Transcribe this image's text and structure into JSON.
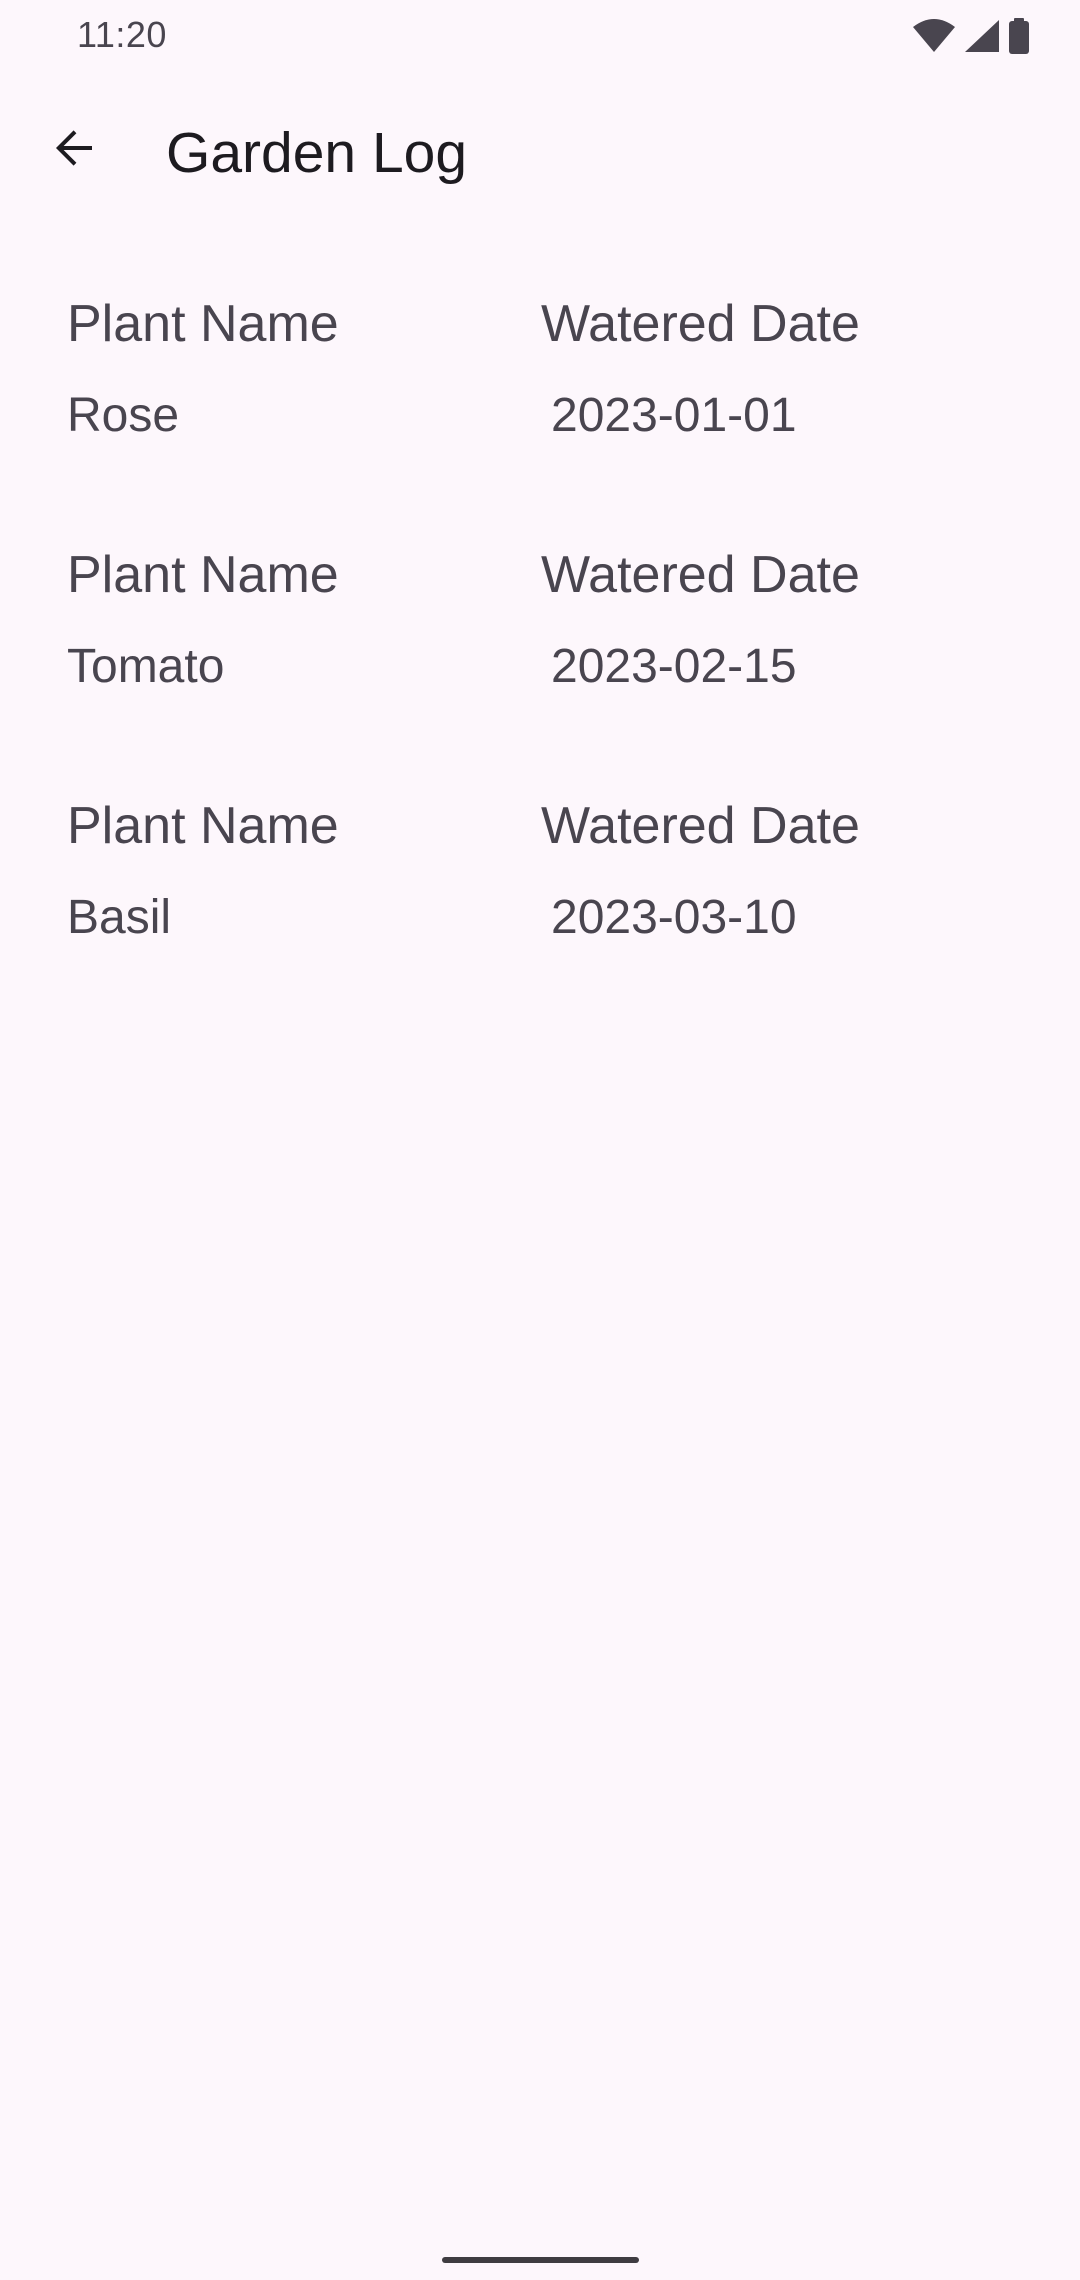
{
  "status_bar": {
    "time": "11:20",
    "icons": [
      "wifi-icon",
      "signal-icon",
      "battery-icon"
    ]
  },
  "app_bar": {
    "back_icon": "arrow-back-icon",
    "title": "Garden Log"
  },
  "log": {
    "entries": [
      {
        "plant_header": "Plant Name",
        "date_header": "Watered Date",
        "plant": "Rose",
        "date": "2023-01-01"
      },
      {
        "plant_header": "Plant Name",
        "date_header": "Watered Date",
        "plant": "Tomato",
        "date": "2023-02-15"
      },
      {
        "plant_header": "Plant Name",
        "date_header": "Watered Date",
        "plant": "Basil",
        "date": "2023-03-10"
      }
    ]
  },
  "colors": {
    "background": "#fdf7fc",
    "primary_text": "#1d1b20",
    "secondary_text": "#49454f"
  }
}
